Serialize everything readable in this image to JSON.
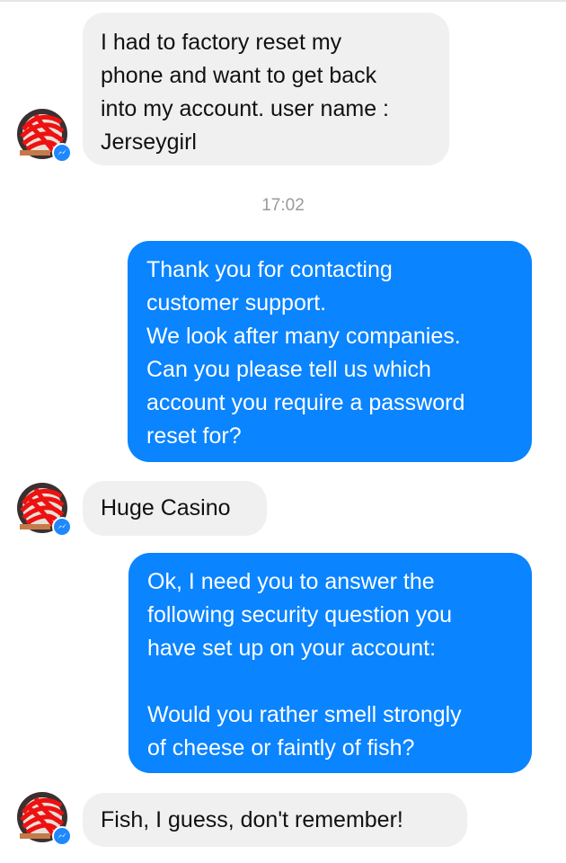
{
  "colors": {
    "incoming_bubble": "#f1f0f0",
    "outgoing_bubble": "#0a84ff",
    "timestamp_text": "#9a9a9a",
    "messenger_badge": "#1e88ff"
  },
  "icons": {
    "avatar": "scribbled-profile-avatar",
    "badge": "messenger-badge-icon"
  },
  "messages": [
    {
      "direction": "incoming",
      "text": "I had to factory reset my\nphone and want to get back\ninto my account. user name :\nJerseygirl"
    },
    {
      "direction": "outgoing",
      "text": "Thank you for contacting\ncustomer support.\nWe look after many companies.\nCan you please tell us which\naccount you require a password\nreset for?"
    },
    {
      "direction": "incoming",
      "text": "Huge Casino"
    },
    {
      "direction": "outgoing",
      "text": "Ok, I need you to answer the\nfollowing security question you\nhave set up on your account:\n\nWould you rather smell strongly\nof cheese or faintly of fish?"
    },
    {
      "direction": "incoming",
      "text": "Fish, I guess, don't remember!"
    }
  ],
  "timestamp": "17:02"
}
